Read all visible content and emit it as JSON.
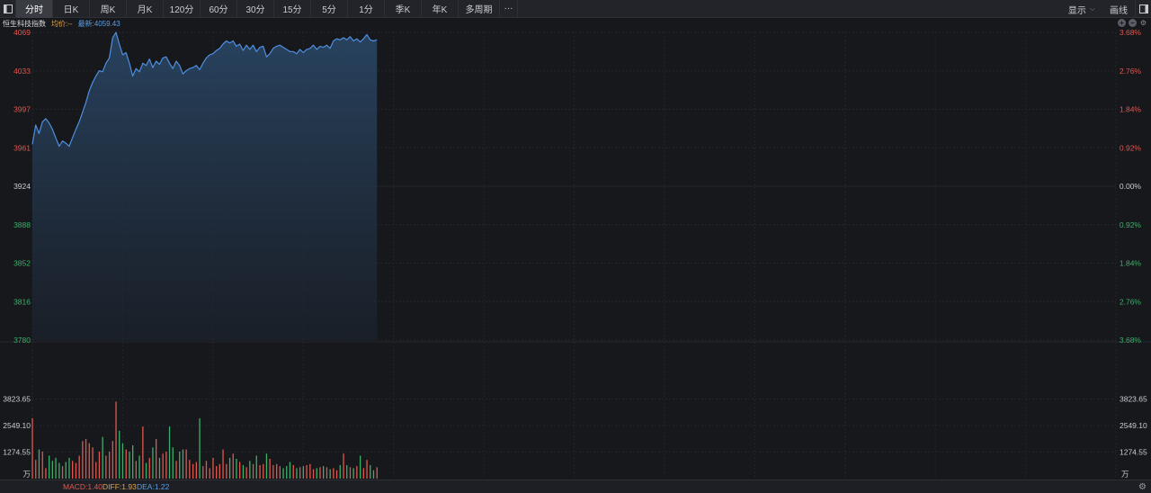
{
  "toolbar": {
    "tabs": [
      "分时",
      "日K",
      "周K",
      "月K",
      "120分",
      "60分",
      "30分",
      "15分",
      "5分",
      "1分",
      "季K",
      "年K",
      "多周期",
      "···"
    ],
    "active_tab": 0,
    "display_label": "显示",
    "draw_label": "画线"
  },
  "info": {
    "name": "恒生科技指数",
    "avg": "均价:--",
    "last": "最新:4059.43"
  },
  "axes": {
    "price_ticks": [
      "4069",
      "4033",
      "3997",
      "3961",
      "3924",
      "3888",
      "3852",
      "3816",
      "3780"
    ],
    "pct_ticks": [
      "3.68%",
      "2.76%",
      "1.84%",
      "0.92%",
      "0.00%",
      "0.92%",
      "1.84%",
      "2.76%",
      "3.68%"
    ],
    "volume_ticks": [
      "3823.65",
      "2549.10",
      "1274.55"
    ],
    "volume_unit": "万"
  },
  "indicators": {
    "macd": "MACD:1.40",
    "diff": "DIFF:1.93",
    "dea": "DEA:1.22"
  },
  "colors": {
    "background": "#17181c",
    "line": "#4f8fdf",
    "up": "#e0574f",
    "down": "#3fae6a",
    "neutral": "#c9ccd4"
  },
  "chart_data": {
    "type": "line",
    "name": "恒生科技指数",
    "prev_close": 3924,
    "ylim": [
      3780,
      4069
    ],
    "price": [
      3964,
      3982,
      3974,
      3985,
      3988,
      3984,
      3978,
      3970,
      3962,
      3967,
      3965,
      3962,
      3970,
      3978,
      3985,
      3994,
      4003,
      4014,
      4022,
      4028,
      4033,
      4032,
      4040,
      4045,
      4064,
      4069,
      4058,
      4048,
      4050,
      4040,
      4028,
      4035,
      4032,
      4040,
      4038,
      4044,
      4036,
      4042,
      4039,
      4045,
      4046,
      4040,
      4035,
      4042,
      4038,
      4030,
      4033,
      4035,
      4036,
      4038,
      4034,
      4040,
      4045,
      4048,
      4049,
      4052,
      4054,
      4058,
      4061,
      4059,
      4061,
      4056,
      4058,
      4052,
      4057,
      4053,
      4057,
      4051,
      4055,
      4056,
      4046,
      4049,
      4054,
      4056,
      4057,
      4055,
      4053,
      4051,
      4051,
      4049,
      4053,
      4050,
      4053,
      4054,
      4057,
      4053,
      4056,
      4055,
      4057,
      4054,
      4061,
      4063,
      4062,
      4064,
      4062,
      4065,
      4061,
      4063,
      4060,
      4063,
      4067,
      4062,
      4061,
      4062
    ],
    "volume": [
      2900,
      900,
      1400,
      1300,
      500,
      1100,
      850,
      1000,
      750,
      600,
      800,
      1000,
      850,
      750,
      1100,
      1800,
      1900,
      1700,
      1500,
      800,
      1300,
      2000,
      1100,
      1300,
      1800,
      3700,
      2300,
      1700,
      1400,
      1300,
      1600,
      850,
      1100,
      2500,
      750,
      1000,
      1500,
      1900,
      1000,
      1200,
      1300,
      2500,
      1500,
      850,
      1300,
      1400,
      1400,
      900,
      700,
      800,
      2900,
      600,
      850,
      500,
      1000,
      600,
      700,
      1400,
      700,
      1000,
      1200,
      950,
      800,
      650,
      550,
      850,
      700,
      1100,
      650,
      700,
      1200,
      950,
      650,
      700,
      600,
      500,
      600,
      800,
      650,
      500,
      550,
      600,
      650,
      700,
      450,
      500,
      550,
      600,
      550,
      450,
      500,
      400,
      650,
      1200,
      650,
      550,
      500,
      600,
      1100,
      500,
      900,
      650,
      400,
      550
    ]
  }
}
